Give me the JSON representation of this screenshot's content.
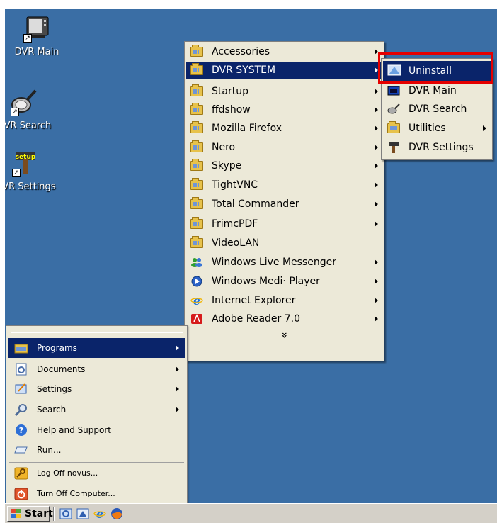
{
  "desktop": {
    "icons": [
      {
        "label": "DVR Main"
      },
      {
        "label": "DVR Search"
      },
      {
        "label": "DVR Settings"
      }
    ],
    "background": "#3a6ea5"
  },
  "programs_menu": {
    "items": [
      {
        "label": "Accessories",
        "submenu": true
      },
      {
        "label": "DVR SYSTEM",
        "submenu": true,
        "selected": true
      },
      {
        "label": "Startup",
        "submenu": true
      },
      {
        "label": "ffdshow",
        "submenu": true
      },
      {
        "label": "Mozilla Firefox",
        "submenu": true
      },
      {
        "label": "Nero",
        "submenu": true
      },
      {
        "label": "Skype",
        "submenu": true
      },
      {
        "label": "TightVNC",
        "submenu": true
      },
      {
        "label": "Total Commander",
        "submenu": true
      },
      {
        "label": "FrimcPDF",
        "submenu": true
      },
      {
        "label": "VideoLAN",
        "submenu": false
      },
      {
        "label": "Windows Live Messenger",
        "submenu": true
      },
      {
        "label": "Windows Medi· Player",
        "submenu": true
      },
      {
        "label": "Internet Explorer",
        "submenu": true
      },
      {
        "label": "Adobe Reader 7.0",
        "submenu": true
      }
    ],
    "expand_glyph": "»"
  },
  "dvr_submenu": {
    "items": [
      {
        "label": "Uninstall",
        "selected": true
      },
      {
        "label": "DVR Main"
      },
      {
        "label": "DVR Search"
      },
      {
        "label": "Utilities",
        "submenu": true
      },
      {
        "label": "DVR Settings"
      }
    ]
  },
  "start_menu": {
    "items": [
      {
        "label": "Programs",
        "submenu": true,
        "selected": true
      },
      {
        "label": "Documents",
        "submenu": true
      },
      {
        "label": "Settings",
        "submenu": true
      },
      {
        "label": "Search",
        "submenu": true
      },
      {
        "label": "Help and Support"
      },
      {
        "label": "Run..."
      },
      {
        "label": "Log Off novus..."
      },
      {
        "label": "Turn Off Computer..."
      }
    ]
  },
  "taskbar": {
    "start_label": "Start",
    "quick_launch": [
      "show-desktop-icon",
      "media-player-icon",
      "internet-explorer-icon",
      "firefox-icon"
    ]
  },
  "colors": {
    "selection": "#0a246a",
    "highlight_box": "#e50000",
    "menu_bg": "#ece9d8"
  }
}
